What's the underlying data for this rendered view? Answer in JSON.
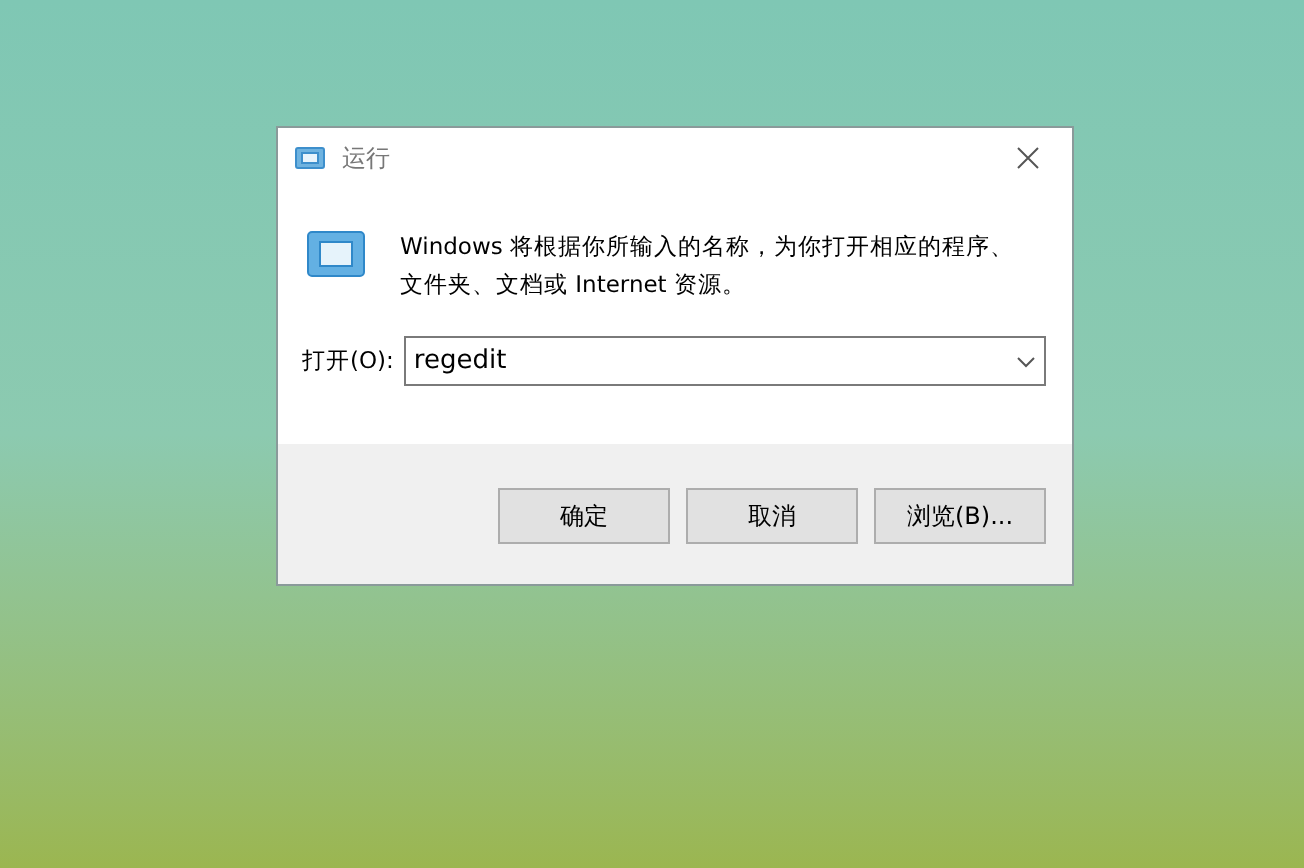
{
  "window": {
    "title": "运行"
  },
  "message": "Windows 将根据你所输入的名称，为你打开相应的程序、文件夹、文档或 Internet 资源。",
  "open_field": {
    "label": "打开(O):",
    "value": "regedit"
  },
  "buttons": [
    {
      "label": "确定"
    },
    {
      "label": "取消"
    },
    {
      "label": "浏览(B)..."
    }
  ]
}
